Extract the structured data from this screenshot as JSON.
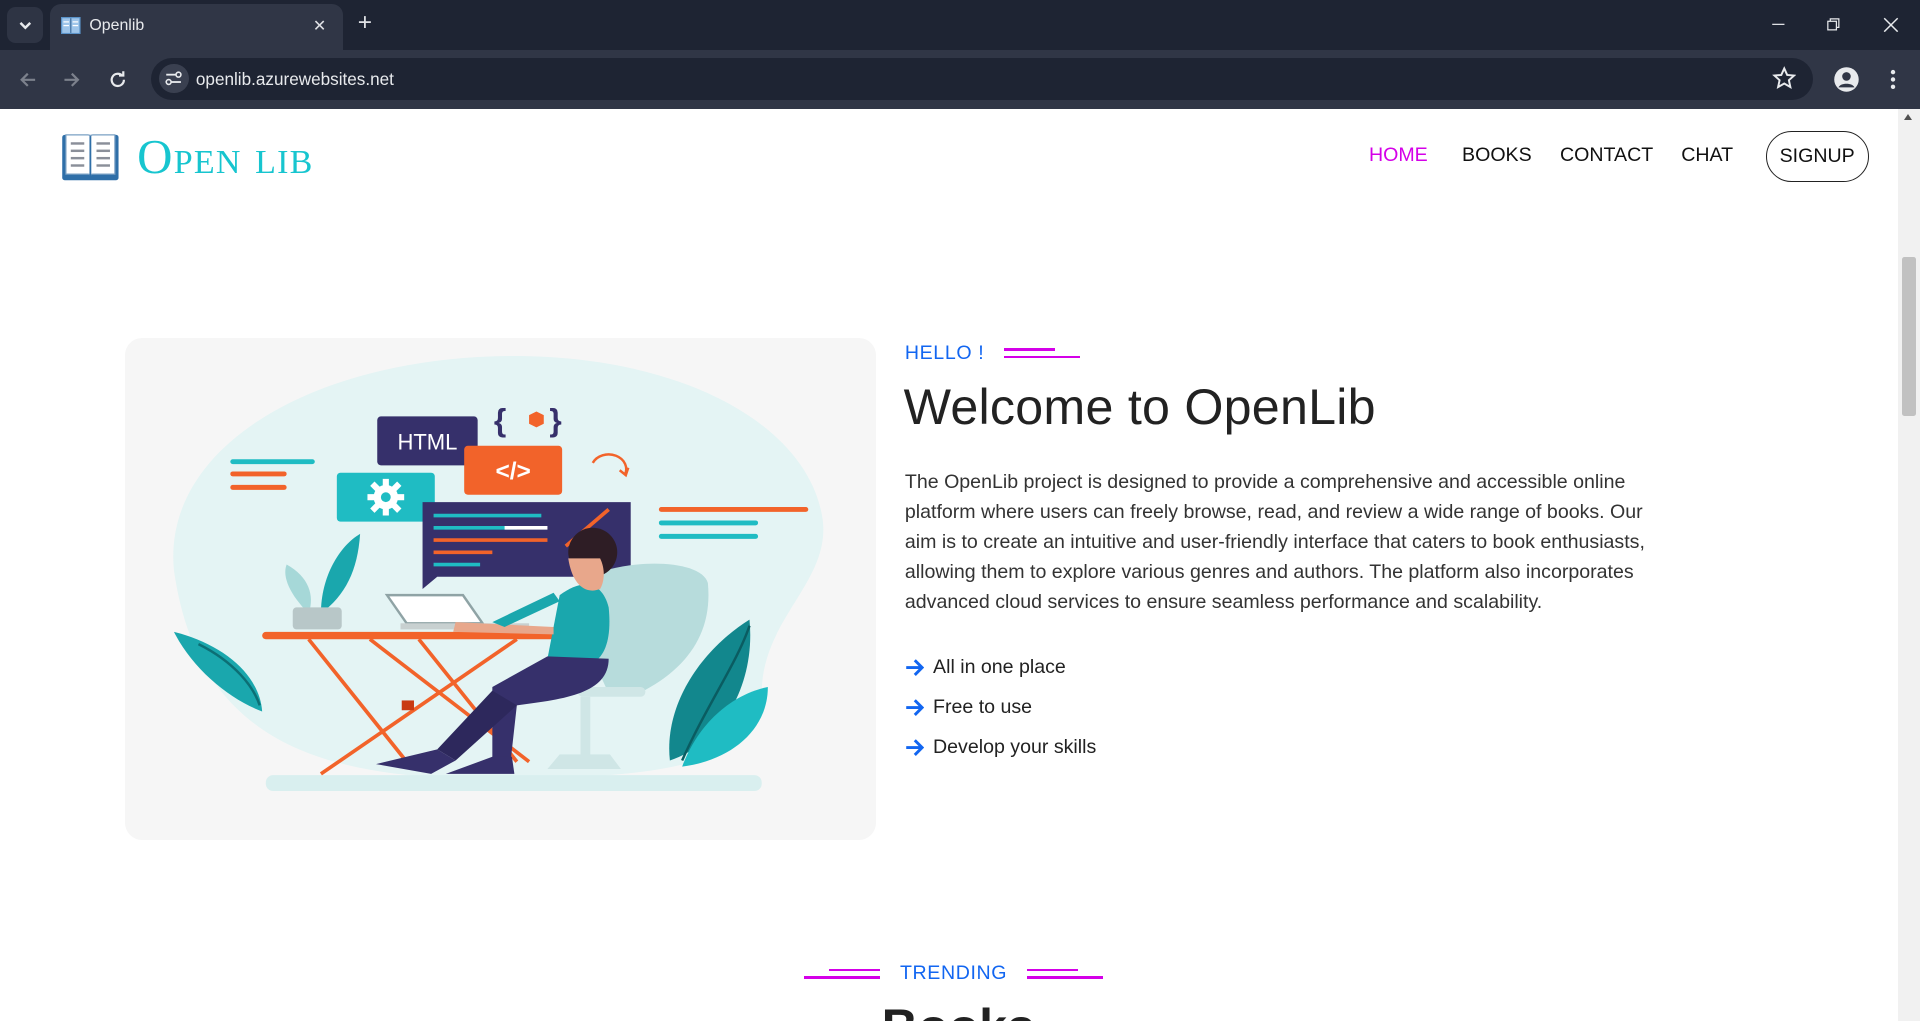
{
  "browser": {
    "tab_title": "Openlib",
    "url": "openlib.azurewebsites.net"
  },
  "site": {
    "brand": "Open lib",
    "nav": [
      {
        "label": "HOME",
        "active": true
      },
      {
        "label": "BOOKS",
        "active": false
      },
      {
        "label": "CONTACT",
        "active": false
      },
      {
        "label": "CHAT",
        "active": false
      }
    ],
    "signup_label": "SIGNUP"
  },
  "hero": {
    "eyebrow": "HELLO !",
    "title": "Welcome to OpenLib",
    "description": "The OpenLib project is designed to provide a comprehensive and accessible online platform where users can freely browse, read, and review a wide range of books. Our aim is to create an intuitive and user-friendly interface that caters to book enthusiasts, allowing them to explore various genres and authors. The platform also incorporates advanced cloud services to ensure seamless performance and scalability.",
    "features": [
      "All in one place",
      "Free to use",
      "Develop your skills"
    ],
    "illustration": {
      "html_label": "HTML",
      "code_label": "</>",
      "braces_label": "{ }"
    }
  },
  "trending": {
    "eyebrow": "TRENDING",
    "heading": "Books"
  },
  "colors": {
    "brand": "#17c5cf",
    "accent": "#d400e8",
    "link_blue": "#1266f1",
    "chrome_dark": "#1e2433",
    "chrome_mid": "#303646"
  },
  "icons": [
    "tab-search-icon",
    "book-favicon-icon",
    "close-icon",
    "plus-icon",
    "minimize-icon",
    "restore-icon",
    "back-icon",
    "forward-icon",
    "reload-icon",
    "site-info-icon",
    "star-icon",
    "profile-icon",
    "kebab-menu-icon",
    "open-book-logo-icon",
    "arrow-right-icon"
  ]
}
